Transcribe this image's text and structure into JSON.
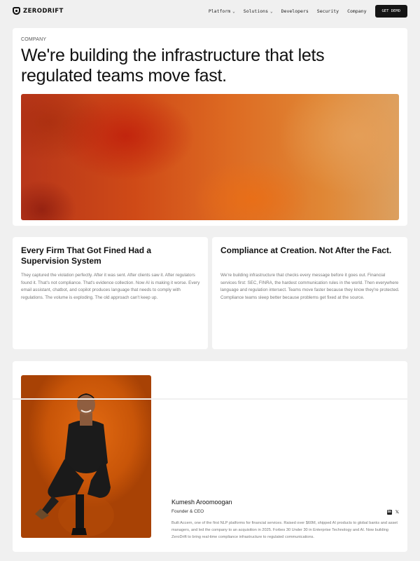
{
  "nav": {
    "logo_text": "ZERODRIFT",
    "links": [
      {
        "label": "Platform",
        "dropdown": true
      },
      {
        "label": "Solutions",
        "dropdown": true
      },
      {
        "label": "Developers",
        "dropdown": false
      },
      {
        "label": "Security",
        "dropdown": false
      },
      {
        "label": "Company",
        "dropdown": false
      }
    ],
    "cta_label": "GET DEMO"
  },
  "hero": {
    "eyebrow": "COMPANY",
    "headline": "We're building the infrastructure that lets regulated teams move fast."
  },
  "columns": [
    {
      "title": "Every Firm That Got Fined Had a Supervision System",
      "body": "They captured the violation perfectly. After it was sent. After clients saw it. After regulators found it. That's not compliance. That's evidence collection. Now AI is making it worse. Every email assistant, chatbot, and copilot produces language that needs to comply with regulations. The volume is exploding. The old approach can't keep up."
    },
    {
      "title": "Compliance at Creation. Not After the Fact.",
      "body": "We're building infrastructure that checks every message before it goes out. Financial services first: SEC, FINRA, the hardest communication rules in the world. Then everywhere language and regulation intersect. Teams move faster because they know they're protected. Compliance teams sleep better because problems get fixed at the source."
    }
  ],
  "team": {
    "name": "Kumesh Aroomoogan",
    "role": "Founder & CEO",
    "bio": "Built Accern, one of the first NLP platforms for financial services. Raised over $60M, shipped AI products to global banks and asset managers, and led the company to an acquisition in 2025. Forbes 30 Under 30 in Enterprise Technology and AI. Now building ZeroDrift to bring real-time compliance infrastructure to regulated communications.",
    "socials": [
      "linkedin-icon",
      "x-icon"
    ],
    "social_labels": {
      "linkedin": "in",
      "x": "𝕏"
    }
  },
  "colors": {
    "background": "#f0f0f0",
    "card": "#ffffff",
    "cta": "#151515",
    "hero_orange": "#dd6a22",
    "photo_orange": "#e26a12"
  }
}
